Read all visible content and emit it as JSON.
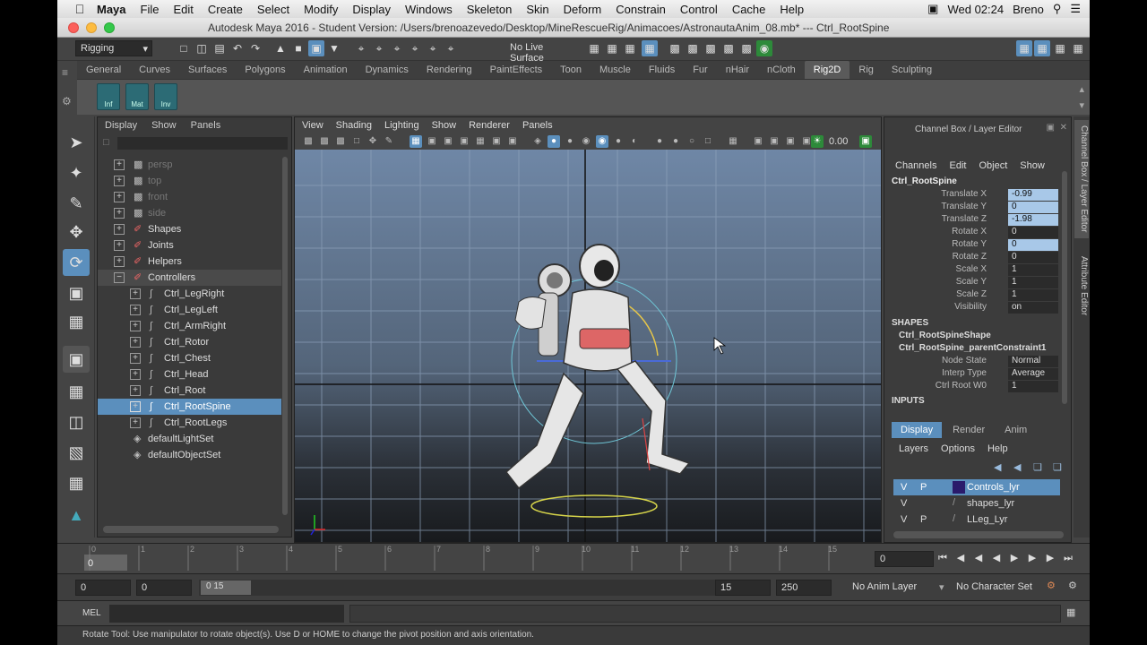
{
  "mac_menu": {
    "app": "Maya",
    "items": [
      "File",
      "Edit",
      "Create",
      "Select",
      "Modify",
      "Display",
      "Windows",
      "Skeleton",
      "Skin",
      "Deform",
      "Constrain",
      "Control",
      "Cache",
      "Help"
    ],
    "clock": "Wed 02:24",
    "user": "Breno"
  },
  "window": {
    "title": "Autodesk Maya 2016 - Student Version: /Users/brenoazevedo/Desktop/MineRescueRig/Animacoes/AstronautaAnim_08.mb*   ---   Ctrl_RootSpine"
  },
  "status_line": {
    "menu_set": "Rigging",
    "live_surface": "No Live Surface"
  },
  "shelf": {
    "tabs": [
      "General",
      "Curves",
      "Surfaces",
      "Polygons",
      "Animation",
      "Dynamics",
      "Rendering",
      "PaintEffects",
      "Toon",
      "Muscle",
      "Fluids",
      "Fur",
      "nHair",
      "nCloth",
      "Rig2D",
      "Rig",
      "Sculpting"
    ],
    "active_tab": "Rig2D",
    "buttons": [
      "Inf",
      "Mat",
      "Inv"
    ]
  },
  "outliner": {
    "menu": [
      "Display",
      "Show",
      "Panels"
    ],
    "items": [
      {
        "label": "persp"
      },
      {
        "label": "top"
      },
      {
        "label": "front"
      },
      {
        "label": "side"
      },
      {
        "label": "Shapes"
      },
      {
        "label": "Joints"
      },
      {
        "label": "Helpers"
      },
      {
        "label": "Controllers"
      },
      {
        "label": "Ctrl_LegRight"
      },
      {
        "label": "Ctrl_LegLeft"
      },
      {
        "label": "Ctrl_ArmRight"
      },
      {
        "label": "Ctrl_Rotor"
      },
      {
        "label": "Ctrl_Chest"
      },
      {
        "label": "Ctrl_Head"
      },
      {
        "label": "Ctrl_Root"
      },
      {
        "label": "Ctrl_RootSpine"
      },
      {
        "label": "Ctrl_RootLegs"
      },
      {
        "label": "defaultLightSet"
      },
      {
        "label": "defaultObjectSet"
      }
    ]
  },
  "viewport": {
    "menu": [
      "View",
      "Shading",
      "Lighting",
      "Show",
      "Renderer",
      "Panels"
    ],
    "exposure": "0.00"
  },
  "channel_box": {
    "header": "Channel Box / Layer Editor",
    "menu": [
      "Channels",
      "Edit",
      "Object",
      "Show"
    ],
    "object": "Ctrl_RootSpine",
    "channels": [
      {
        "name": "Translate X",
        "value": "-0.99"
      },
      {
        "name": "Translate Y",
        "value": "0"
      },
      {
        "name": "Translate Z",
        "value": "-1.98"
      },
      {
        "name": "Rotate X",
        "value": "0"
      },
      {
        "name": "Rotate Y",
        "value": "0"
      },
      {
        "name": "Rotate Z",
        "value": "0"
      },
      {
        "name": "Scale X",
        "value": "1"
      },
      {
        "name": "Scale Y",
        "value": "1"
      },
      {
        "name": "Scale Z",
        "value": "1"
      },
      {
        "name": "Visibility",
        "value": "on"
      }
    ],
    "shapes_label": "SHAPES",
    "shape_nodes": [
      "Ctrl_RootSpineShape",
      "Ctrl_RootSpine_parentConstraint1"
    ],
    "constraint": [
      {
        "name": "Node State",
        "value": "Normal"
      },
      {
        "name": "Interp Type",
        "value": "Average"
      },
      {
        "name": "Ctrl Root W0",
        "value": "1"
      }
    ],
    "inputs_label": "INPUTS"
  },
  "layer_editor": {
    "tabs": [
      "Display",
      "Render",
      "Anim"
    ],
    "menu": [
      "Layers",
      "Options",
      "Help"
    ],
    "layers": [
      {
        "v": "V",
        "p": "P",
        "name": "Controls_lyr",
        "color": "#2a1a6b"
      },
      {
        "v": "V",
        "p": "",
        "name": "shapes_lyr",
        "color": ""
      },
      {
        "v": "V",
        "p": "P",
        "name": "LLeg_Lyr",
        "color": ""
      }
    ]
  },
  "side_tabs": [
    "Channel Box / Layer Editor",
    "Attribute Editor"
  ],
  "time_slider": {
    "ticks": [
      "0",
      "1",
      "2",
      "3",
      "4",
      "5",
      "6",
      "7",
      "8",
      "9",
      "10",
      "11",
      "12",
      "13",
      "14",
      "15"
    ],
    "current_frame": "0",
    "frame_field": "0"
  },
  "range_slider": {
    "start": "0",
    "playback_start": "0",
    "range_label": "0 15",
    "playback_end": "15",
    "end": "250",
    "anim_layer": "No Anim Layer",
    "character_set": "No Character Set"
  },
  "command_line": {
    "label": "MEL"
  },
  "help_line": {
    "text": "Rotate Tool: Use manipulator to rotate object(s). Use D or HOME to change the pivot position and axis orientation."
  }
}
